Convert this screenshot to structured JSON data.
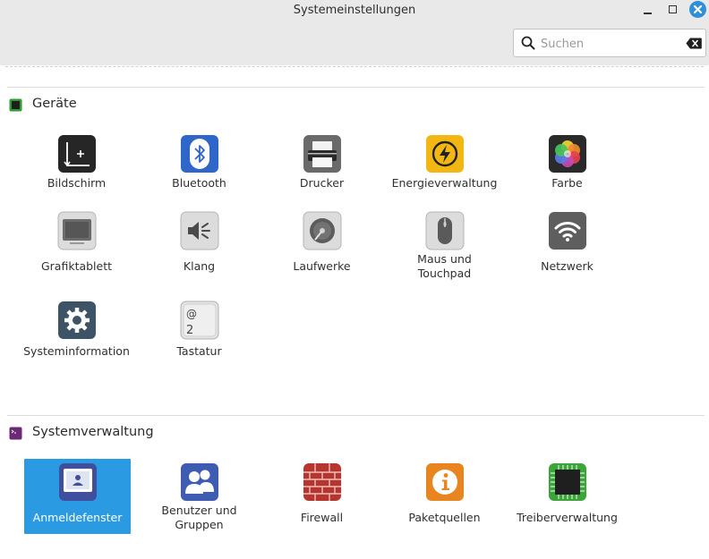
{
  "window": {
    "title": "Systemeinstellungen"
  },
  "search": {
    "placeholder": "Suchen",
    "value": ""
  },
  "colors": {
    "accent": "#2a9be3",
    "close_button": "#2f8fd8"
  },
  "sections": [
    {
      "title": "Geräte",
      "icon": "chip-green-icon",
      "items": [
        {
          "label": "Bildschirm",
          "icon": "display-arrows-icon"
        },
        {
          "label": "Bluetooth",
          "icon": "bluetooth-icon"
        },
        {
          "label": "Drucker",
          "icon": "printer-icon"
        },
        {
          "label": "Energieverwaltung",
          "icon": "power-lightning-icon"
        },
        {
          "label": "Farbe",
          "icon": "color-flower-icon"
        },
        {
          "label": "Grafiktablett",
          "icon": "tablet-icon"
        },
        {
          "label": "Klang",
          "icon": "speaker-icon"
        },
        {
          "label": "Laufwerke",
          "icon": "disk-drive-icon"
        },
        {
          "label": "Maus und\nTouchpad",
          "icon": "mouse-icon"
        },
        {
          "label": "Netzwerk",
          "icon": "wifi-icon"
        },
        {
          "label": "Systeminformation",
          "icon": "gear-icon"
        },
        {
          "label": "Tastatur",
          "icon": "keyboard-key-icon",
          "key_chars": [
            "@",
            "2"
          ]
        }
      ]
    },
    {
      "title": "Systemverwaltung",
      "icon": "terminal-purple-icon",
      "items": [
        {
          "label": "Anmeldefenster",
          "icon": "login-window-icon",
          "selected": true
        },
        {
          "label": "Benutzer und\nGruppen",
          "icon": "users-icon"
        },
        {
          "label": "Firewall",
          "icon": "brick-wall-icon"
        },
        {
          "label": "Paketquellen",
          "icon": "info-package-icon"
        },
        {
          "label": "Treiberverwaltung",
          "icon": "driver-chip-icon"
        }
      ]
    }
  ]
}
